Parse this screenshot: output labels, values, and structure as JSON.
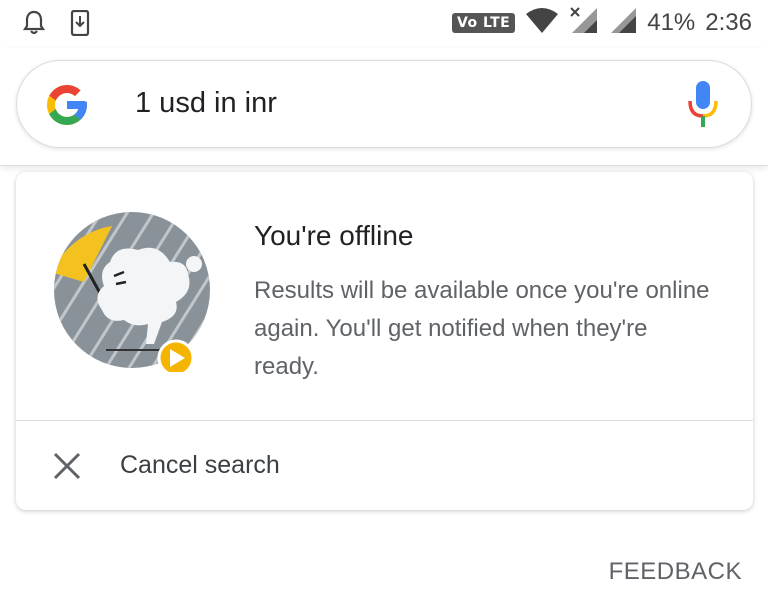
{
  "status_bar": {
    "volte_label": "Vo LTE",
    "battery": "41%",
    "time": "2:36"
  },
  "search": {
    "query": "1 usd in inr"
  },
  "offline_card": {
    "title": "You're offline",
    "body": "Results will be available once you're online again. You'll get notified when they're ready.",
    "cancel_label": "Cancel search"
  },
  "footer": {
    "feedback_label": "FEEDBACK"
  },
  "icons": {
    "status_left": [
      "notification-bell-icon",
      "download-icon"
    ],
    "status_right": [
      "wifi-icon",
      "signal-icon",
      "signal-icon"
    ],
    "search": [
      "google-logo-icon",
      "mic-icon"
    ],
    "card": [
      "offline-illustration",
      "close-icon"
    ]
  },
  "colors": {
    "google_blue": "#4285F4",
    "google_red": "#EA4335",
    "google_yellow": "#FBBC05",
    "google_green": "#34A853",
    "play_badge": "#F4B400"
  }
}
